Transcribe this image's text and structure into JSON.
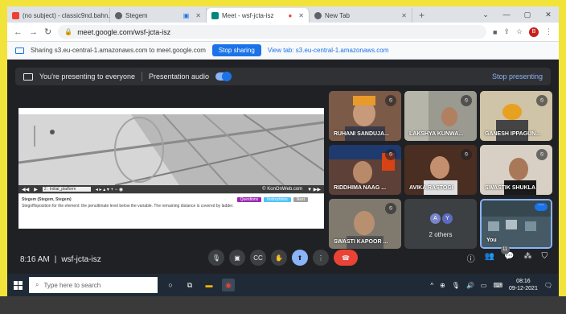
{
  "tabs": [
    {
      "title": "(no subject) - classic9nd.bahn...",
      "color": "#ea4335"
    },
    {
      "title": "Stegem",
      "color": "#5f6368"
    },
    {
      "title": "Meet - wsf-jcta-isz",
      "color": "#00897b"
    },
    {
      "title": "New Tab",
      "color": "#5f6368"
    }
  ],
  "address": {
    "url": "meet.google.com/wsf-jcta-isz"
  },
  "profile_initial": "B",
  "sharing": {
    "text": "Sharing s3.eu-central-1.amazonaws.com to meet.google.com",
    "stop_label": "Stop sharing",
    "view_label": "View tab: s3.eu-central-1.amazonaws.com"
  },
  "presenting": {
    "text": "You're presenting to everyone",
    "audio_label": "Presentation audio",
    "stop_label": "Stop presenting"
  },
  "presentation": {
    "field": "2 : Initial_platform",
    "site": "© KonOnWeb.com",
    "doc_title": "Stegem (Stegem, Stegem)",
    "doc_text": "Stegoffixposition for the element: the penultimate level below the variable. The remaining distance is covered by ladder.",
    "btn1": "Questions",
    "btn2": "Instructions",
    "btn3": "Next"
  },
  "participants": [
    {
      "name": "RUHANI SANDUJA...",
      "bg": "#6d4c41"
    },
    {
      "name": "LAKSHYA KUNWA...",
      "bg": "#8d8d85"
    },
    {
      "name": "GANESH IPPAGUN...",
      "bg": "#b8aa90"
    },
    {
      "name": "RIDDHIMA NAAG ...",
      "bg": "#4e342e"
    },
    {
      "name": "AVIKA RASTOGI",
      "bg": "#5a3a2c"
    },
    {
      "name": "SWASTIK SHUKLA",
      "bg": "#7a6a58"
    },
    {
      "name": "SWASTI KAPOOR ...",
      "bg": "#6f6a60"
    }
  ],
  "others": {
    "label": "2 others",
    "initials": [
      "A",
      "Y"
    ],
    "colors": [
      "#7986cb",
      "#5c6bc0"
    ]
  },
  "you_label": "You",
  "meeting": {
    "time": "8:16 AM",
    "code": "wsf-jcta-isz",
    "people_count": "11"
  },
  "taskbar": {
    "search_placeholder": "Type here to search",
    "time": "08:16",
    "date": "09-12-2021"
  }
}
